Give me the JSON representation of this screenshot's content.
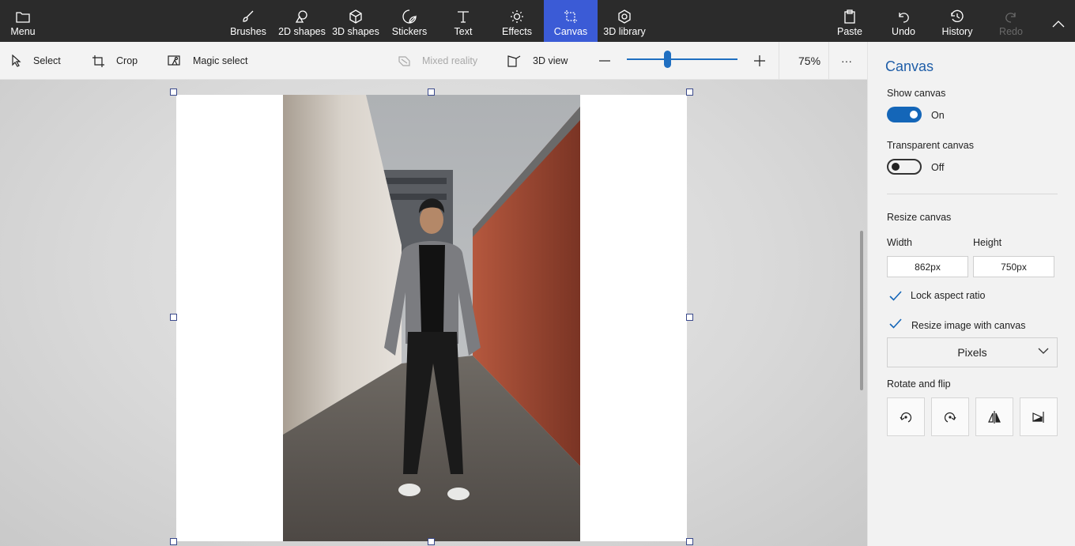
{
  "topbar": {
    "menu_label": "Menu",
    "tools": [
      {
        "label": "Brushes",
        "icon": "brush-icon"
      },
      {
        "label": "2D shapes",
        "icon": "2d-shapes-icon"
      },
      {
        "label": "3D shapes",
        "icon": "3d-shapes-icon"
      },
      {
        "label": "Stickers",
        "icon": "sticker-icon"
      },
      {
        "label": "Text",
        "icon": "text-icon"
      },
      {
        "label": "Effects",
        "icon": "effects-icon"
      },
      {
        "label": "Canvas",
        "icon": "canvas-icon",
        "active": true
      },
      {
        "label": "3D library",
        "icon": "3d-library-icon"
      }
    ],
    "paste_label": "Paste",
    "undo_label": "Undo",
    "history_label": "History",
    "redo_label": "Redo",
    "active_color": "#3b5bd6"
  },
  "toolbar": {
    "select_label": "Select",
    "crop_label": "Crop",
    "magic_select_label": "Magic select",
    "mixed_reality_label": "Mixed reality",
    "view3d_label": "3D view",
    "zoom_value": "75%",
    "more_label": "···"
  },
  "panel": {
    "title": "Canvas",
    "show_canvas_label": "Show canvas",
    "show_canvas_state": "On",
    "transparent_canvas_label": "Transparent canvas",
    "transparent_canvas_state": "Off",
    "resize_canvas_label": "Resize canvas",
    "width_label": "Width",
    "height_label": "Height",
    "width_value": "862px",
    "height_value": "750px",
    "lock_aspect_label": "Lock aspect ratio",
    "resize_image_label": "Resize image with canvas",
    "unit_selected": "Pixels",
    "rotate_flip_label": "Rotate and flip",
    "accent_color": "#1466b8"
  }
}
